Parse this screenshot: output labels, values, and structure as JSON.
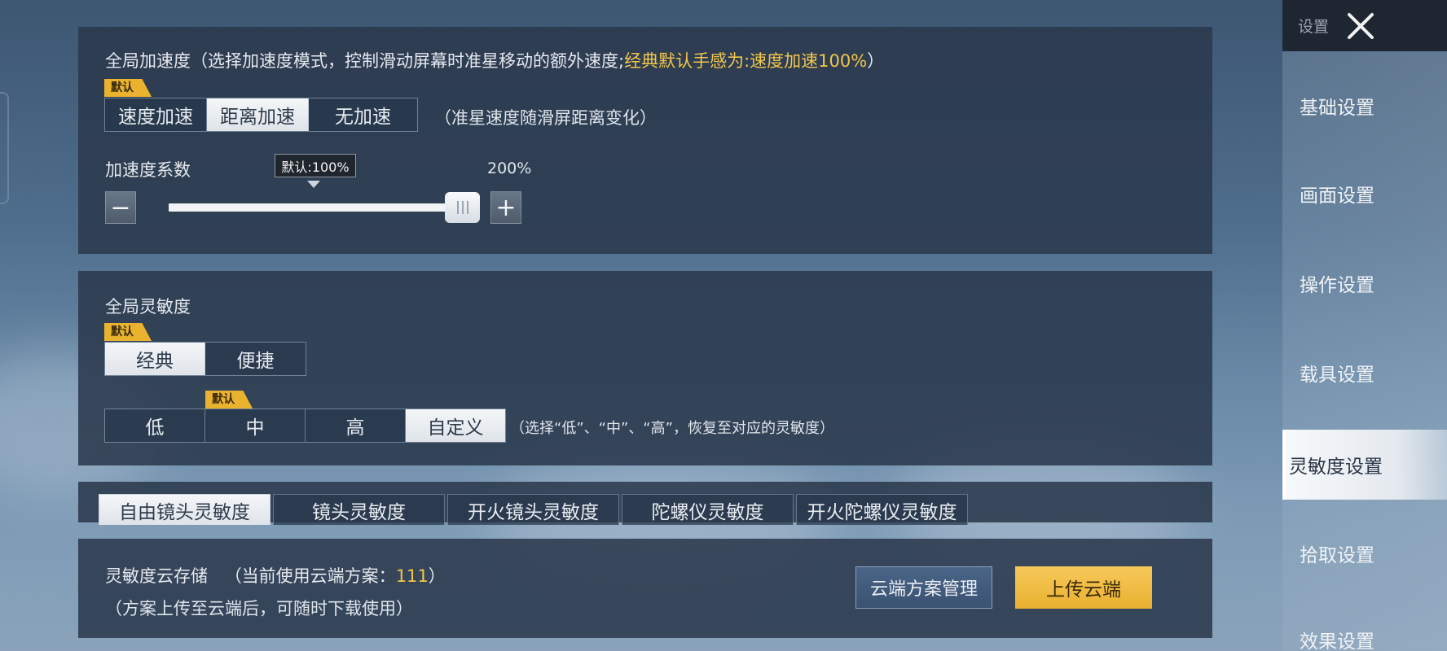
{
  "accel": {
    "title": "全局加速度（选择加速度模式，控制滑动屏幕时准星移动的额外速度;",
    "title_hint": "经典默认手感为:速度加速100%",
    "title_end": "）",
    "default_tag": "默认",
    "modes": [
      "速度加速",
      "距离加速",
      "无加速"
    ],
    "active_mode": "距离加速",
    "mode_note": "（准星速度随滑屏距离变化）",
    "coef_label": "加速度系数",
    "default_tooltip": "默认:100%",
    "value_label": "200%",
    "value": 200,
    "min": 0,
    "max": 200,
    "minus": "−",
    "plus": "+"
  },
  "sensitivity": {
    "title": "全局灵敏度",
    "default_tag": "默认",
    "styles": [
      "经典",
      "便捷"
    ],
    "active_style": "经典",
    "level_default_tag": "默认",
    "levels": [
      "低",
      "中",
      "高",
      "自定义"
    ],
    "active_level": "自定义",
    "level_note": "（选择“低”、“中”、“高”，恢复至对应的灵敏度）"
  },
  "tabs": [
    "自由镜头灵敏度",
    "镜头灵敏度",
    "开火镜头灵敏度",
    "陀螺仪灵敏度",
    "开火陀螺仪灵敏度"
  ],
  "active_tab": "自由镜头灵敏度",
  "cloud": {
    "title": "灵敏度云存储",
    "current_prefix": "（当前使用云端方案：",
    "current_value": "111",
    "current_suffix": "）",
    "note": "（方案上传至云端后，可随时下载使用）",
    "manage_button": "云端方案管理",
    "upload_button": "上传云端"
  },
  "sidebar": {
    "header": "设置",
    "items": [
      "基础设置",
      "画面设置",
      "操作设置",
      "载具设置",
      "灵敏度设置",
      "拾取设置",
      "效果设置"
    ],
    "active": "灵敏度设置"
  },
  "colors": {
    "accent_yellow": "#f2c64a",
    "default_tag": "#e9b32f",
    "panel_bg": "#2b394c"
  }
}
